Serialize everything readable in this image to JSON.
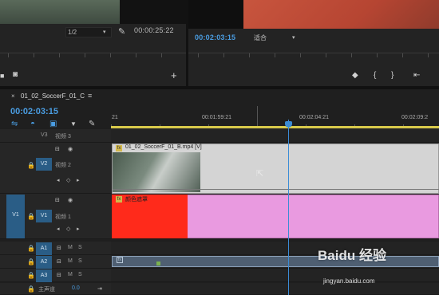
{
  "source_monitor": {
    "zoom_value": "1/2",
    "timecode": "00:00:25:22",
    "buttons": [
      {
        "icon": "marker-in-icon"
      },
      {
        "icon": "camera-icon"
      },
      {
        "icon": "add-icon",
        "label": "+"
      }
    ]
  },
  "program_monitor": {
    "timecode": "00:02:03:15",
    "fit_label": "适合",
    "buttons": [
      {
        "icon": "marker-icon"
      },
      {
        "icon": "mark-in-icon",
        "label": "{"
      },
      {
        "icon": "mark-out-icon",
        "label": "}"
      },
      {
        "icon": "go-to-in-icon"
      }
    ]
  },
  "timeline": {
    "tab_close": "×",
    "sequence_name": "01_02_SoccerF_01_C",
    "menu_icon": "≡",
    "timecode": "00:02:03:15",
    "ruler_labels": [
      "21",
      "00:01:59:21",
      "00:02:04:21",
      "00:02:09:2"
    ],
    "tools": [
      "snap-icon",
      "linked-selection-icon",
      "marker-tool-icon",
      "timeline-settings-icon"
    ],
    "tracks": {
      "v3": {
        "label": "V3",
        "name": "视频 3"
      },
      "v2": {
        "label": "V2",
        "name": "视频 2"
      },
      "v1": {
        "label": "V1",
        "name": "视频 1",
        "source_label": "V1"
      },
      "a1": {
        "label": "A1",
        "m": "M",
        "s": "S"
      },
      "a2": {
        "label": "A2",
        "m": "M",
        "s": "S"
      },
      "a3": {
        "label": "A3",
        "m": "M",
        "s": "S"
      },
      "master": {
        "name": "主声道",
        "value": "0.0"
      }
    },
    "clips": {
      "v2": {
        "fx": "fx",
        "name": "01_02_SoccerF_01_B.mp4 [V]"
      },
      "v1": {
        "fx": "fx",
        "name": "颜色遮罩"
      },
      "a2": {
        "fx": "fx"
      }
    }
  },
  "watermark": {
    "main": "Baidu 经验",
    "sub": "jingyan.baidu.com"
  }
}
